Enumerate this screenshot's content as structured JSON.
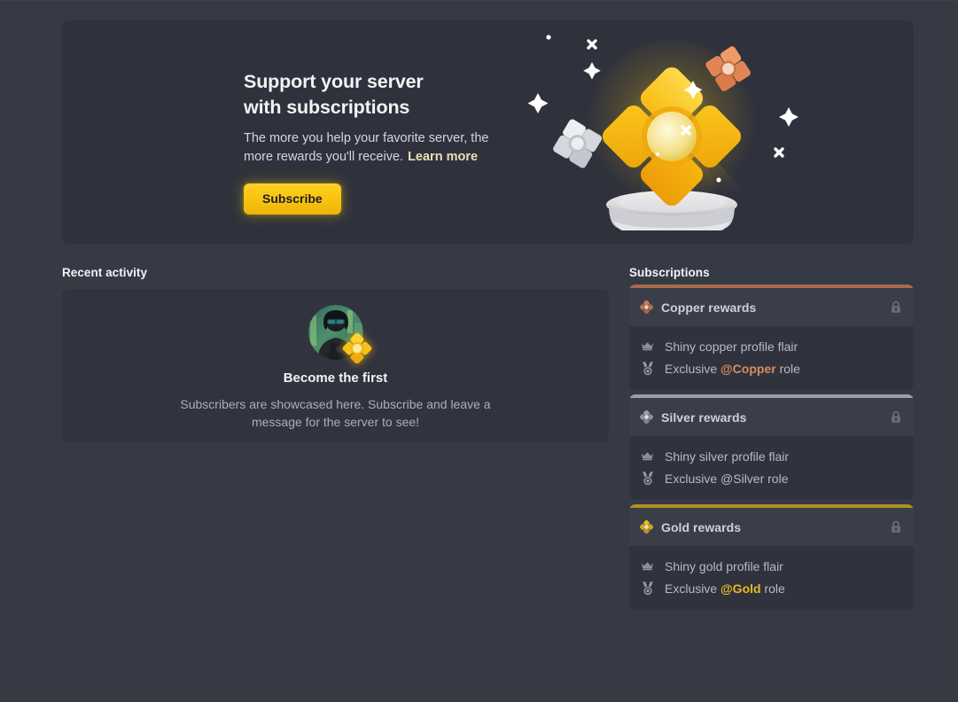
{
  "hero": {
    "title_line1": "Support your server",
    "title_line2": "with subscriptions",
    "description": "The more you help your favorite server, the more rewards you'll receive.",
    "learn_more_label": "Learn more",
    "subscribe_label": "Subscribe",
    "art_name": "gold-subscription-gem-on-pedestal"
  },
  "recent_activity": {
    "section_label": "Recent activity",
    "empty_title": "Become the first",
    "empty_description": "Subscribers are showcased here. Subscribe and leave a message for the server to see!",
    "avatar_alt": "subscriber-avatar",
    "avatar_badge": "gold-gem-badge"
  },
  "subscriptions": {
    "section_label": "Subscriptions",
    "tiers": [
      {
        "name": "Copper rewards",
        "accent": "#a86a4c",
        "emblem_color": "#c87a52",
        "locked": true,
        "perks": [
          {
            "icon": "crown-icon",
            "prefix": "Shiny copper profile flair",
            "role": "",
            "suffix": ""
          },
          {
            "icon": "medal-icon",
            "prefix": "Exclusive ",
            "role": "@Copper",
            "suffix": " role"
          }
        ]
      },
      {
        "name": "Silver rewards",
        "accent": "#9ba0a8",
        "emblem_color": "#9ba0a8",
        "locked": true,
        "perks": [
          {
            "icon": "crown-icon",
            "prefix": "Shiny silver profile flair",
            "role": "",
            "suffix": ""
          },
          {
            "icon": "medal-icon",
            "prefix": "Exclusive ",
            "role": "@Silver",
            "suffix": " role"
          }
        ]
      },
      {
        "name": "Gold rewards",
        "accent": "#b09022",
        "emblem_color": "#e8b923",
        "locked": true,
        "perks": [
          {
            "icon": "crown-icon",
            "prefix": "Shiny gold profile flair",
            "role": "",
            "suffix": ""
          },
          {
            "icon": "medal-icon",
            "prefix": "Exclusive ",
            "role": "@Gold",
            "suffix": " role"
          }
        ]
      }
    ]
  },
  "colors": {
    "page_bg": "#363a45",
    "card_bg": "#2f323c",
    "tier_header_bg": "#3a3e49",
    "accent_gold": "#f8c412",
    "link": "#ecdfb3"
  }
}
